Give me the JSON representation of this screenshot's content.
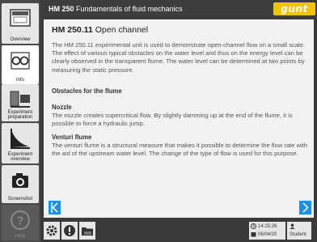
{
  "header": {
    "code": "HM 250",
    "subtitle": "Fundamentals of fluid mechanics",
    "logo": "gunt"
  },
  "sidebar": {
    "items": [
      {
        "label": "Overview",
        "icon": "device-overview-icon"
      },
      {
        "label": "Info",
        "icon": "reading-glasses-icon"
      },
      {
        "label": "Experiment preparation",
        "icon": "device-setup-icon"
      },
      {
        "label": "Experiment overview",
        "icon": "chart-icon"
      },
      {
        "label": "Screenshot",
        "icon": "camera-icon"
      },
      {
        "label": "Help",
        "icon": "help-icon"
      }
    ]
  },
  "main": {
    "heading_code": "HM 250.11",
    "heading_title": "Open channel",
    "intro": "The HM 250.11 experimental unit is used to demonstrate open-channel flow on a small scale. The effect of various typical obstacles on the water level and thus on the energy level can be clearly observed in the transparent flume. The water level can be determined at two points by measuring the static pressure.",
    "section_title": "Obstacles for the flume",
    "nozzle_title": "Nozzle",
    "nozzle_text": "The nozzle creates supercritical flow. By slightly damming up at the end of the flume, it is possible to force a hydraulic jump.",
    "venturi_title": "Venturi flume",
    "venturi_text": "The venturi flume is a structural measure that makes it possible to determine the flow rate with the aid of the upstream water level. The change of the type of flow is used for this purpose."
  },
  "footer": {
    "time": "14:25:26",
    "date": "06/04/20",
    "user": "Student"
  },
  "colors": {
    "accent": "#1e90e8",
    "logo": "#f2c400"
  }
}
